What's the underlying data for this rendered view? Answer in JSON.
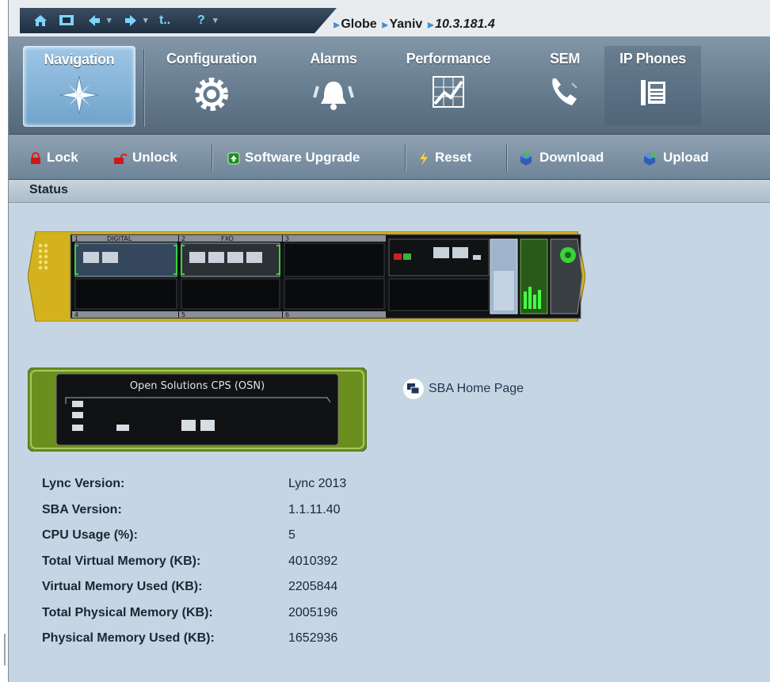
{
  "breadcrumb": {
    "items": [
      "Globe",
      "Yaniv"
    ],
    "ip": "10.3.181.4"
  },
  "quickbar": {
    "icons": [
      "home-icon",
      "screen-icon",
      "back-icon",
      "forward-icon",
      "up-icon",
      "help-icon"
    ],
    "up_label": "t..",
    "help_label": "?"
  },
  "nav": {
    "items": [
      {
        "label": "Navigation",
        "icon": "compass-icon",
        "active": true
      },
      {
        "label": "Configuration",
        "icon": "gear-icon"
      },
      {
        "label": "Alarms",
        "icon": "bell-icon"
      },
      {
        "label": "Performance",
        "icon": "chart-icon"
      },
      {
        "label": "SEM",
        "icon": "phone-handset-icon"
      },
      {
        "label": "IP Phones",
        "icon": "desk-phone-icon"
      }
    ]
  },
  "toolbar": {
    "lock": "Lock",
    "unlock": "Unlock",
    "software_upgrade": "Software Upgrade",
    "reset": "Reset",
    "download": "Download",
    "upload": "Upload"
  },
  "status": {
    "title": "Status"
  },
  "chassis": {
    "slot_labels": [
      "1",
      "DIGITAL",
      "2",
      "FXO",
      "3",
      "4",
      "5",
      "6"
    ]
  },
  "osn": {
    "title": "Open Solutions CPS (OSN)"
  },
  "sba_link": "SBA Home Page",
  "info": [
    {
      "label": "Lync Version:",
      "value": "Lync 2013"
    },
    {
      "label": "SBA Version:",
      "value": "1.1.11.40"
    },
    {
      "label": "CPU Usage (%):",
      "value": "5"
    },
    {
      "label": "Total Virtual Memory (KB):",
      "value": "4010392"
    },
    {
      "label": "Virtual Memory Used (KB):",
      "value": "2205844"
    },
    {
      "label": "Total Physical Memory (KB):",
      "value": "2005196"
    },
    {
      "label": "Physical Memory Used (KB):",
      "value": "1652936"
    }
  ],
  "colors": {
    "background": "#c5d5e3",
    "nav": "#647a8d",
    "active_tab": "#8fbde0",
    "chassis_border": "#d4b21e",
    "osn_green": "#6b8f1f"
  }
}
